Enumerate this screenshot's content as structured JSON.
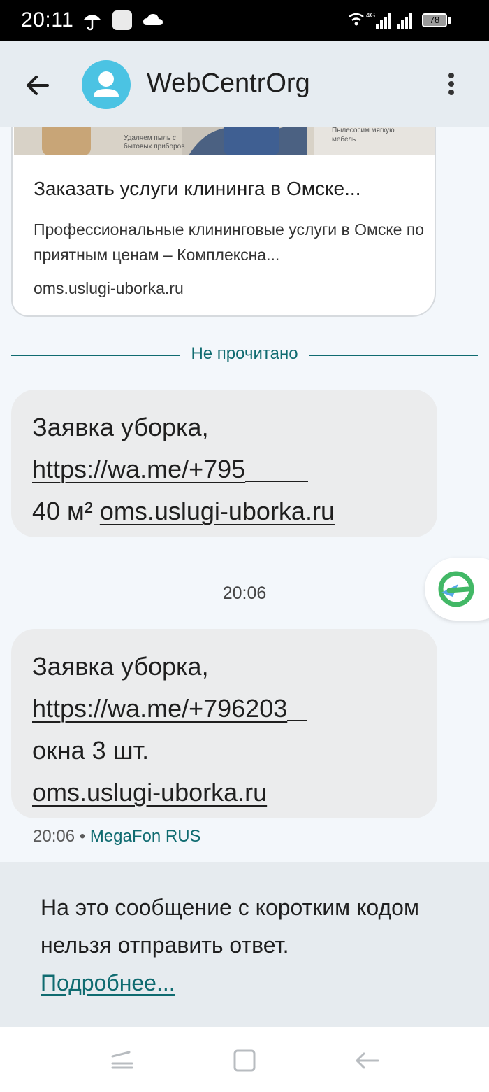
{
  "status_bar": {
    "time": "20:11",
    "network": "4G",
    "battery": "78"
  },
  "app_bar": {
    "title": "WebCentrOrg",
    "avatar_color": "#4bc3e3"
  },
  "preview_card": {
    "image_caption_1": "Удаляем пыль с бытовых приборов",
    "image_caption_2": "Пылесосим мягкую мебель",
    "title": "Заказать услуги клининга в Омске...",
    "description": "Профессиональные клининговые услуги в Омске по приятным ценам – Комплексна...",
    "domain": "oms.uslugi-uborka.ru"
  },
  "divider": {
    "label": "Не прочитано",
    "color": "#0f6b70"
  },
  "messages": [
    {
      "line1": "Заявка уборка,",
      "link": "https://wa.me/+795",
      "line3_prefix": "40 м²",
      "domain": "oms.uslugi-uborka.ru"
    },
    {
      "line1": "Заявка уборка,",
      "link": "https://wa.me/+796203",
      "line3": "окна 3 шт.",
      "domain": "oms.uslugi-uborka.ru"
    }
  ],
  "timestamp": "20:06",
  "message_meta": {
    "time": "20:06",
    "separator": "•",
    "carrier": "MegaFon RUS"
  },
  "notice": {
    "text": "На это сообщение с коротким кодом нельзя отправить ответ.",
    "link": "Подробнее..."
  },
  "icons": {
    "back": "arrow-left-icon",
    "more": "more-vert-icon",
    "avatar": "person-icon",
    "float": "send-icon",
    "nav_recent": "recent-apps-icon",
    "nav_home": "home-icon",
    "nav_back": "back-icon"
  }
}
